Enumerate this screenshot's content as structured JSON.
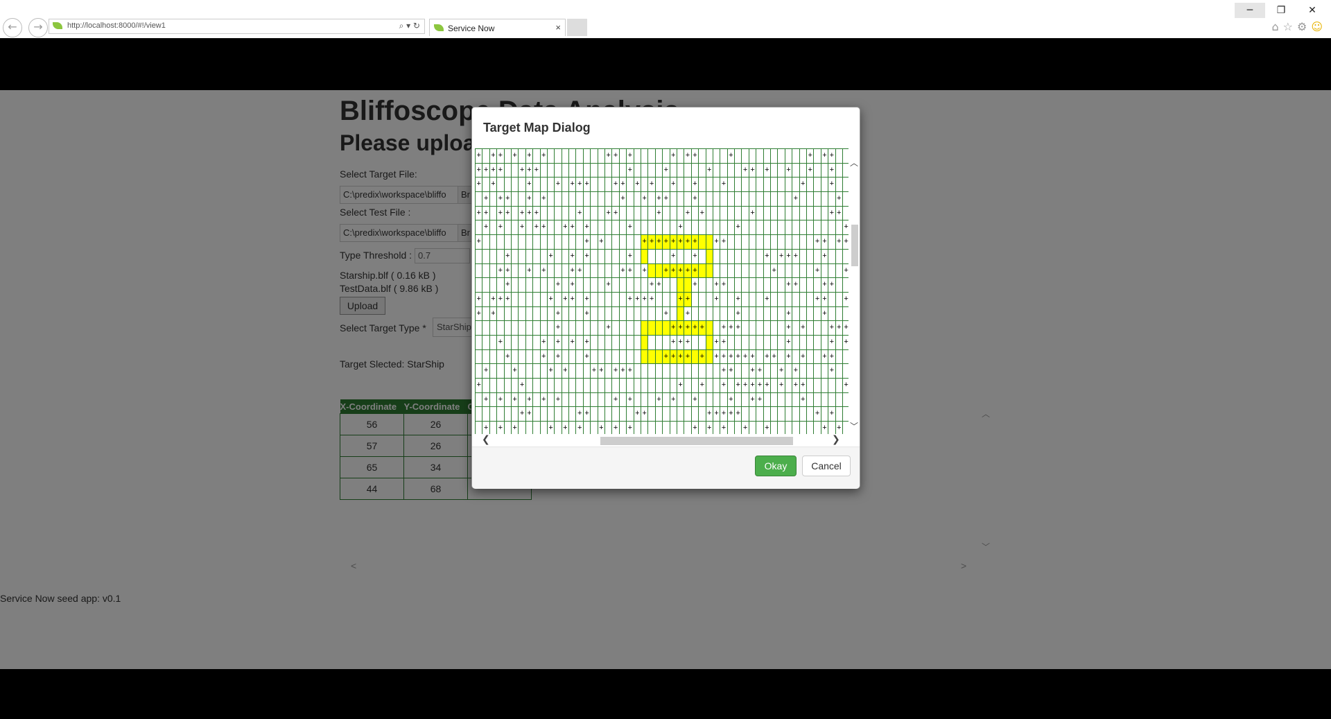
{
  "browser": {
    "url": "http://localhost:8000/#!/view1",
    "tab_title": "Service Now",
    "tab_close": "×",
    "back": "←",
    "forward": "→",
    "addr_tools": "⌕ ▾ ↻",
    "win_min": "─",
    "win_max": "❐",
    "win_close": "✕",
    "icons": "⌂☆⚙"
  },
  "page": {
    "title": "Bliffoscope Data Analysis",
    "subtitle": "Please upload",
    "target_file_label": "Select Target File:",
    "target_file_value": "C:\\predix\\workspace\\bliffo",
    "browse_label": "Br",
    "test_file_label": "Select Test File :",
    "test_file_value": "C:\\predix\\workspace\\bliffo",
    "threshold_label": "Type Threshold :",
    "threshold_value": "0.7",
    "file1": "Starship.blf ( 0.16 kB )",
    "file2": "TestData.blf ( 9.86 kB )",
    "upload_label": "Upload",
    "target_type_label": "Select Target Type *",
    "target_type_value": "StarShip",
    "target_selected": "Target Slected: StarShip",
    "table": {
      "headers": [
        "X-Coordinate",
        "Y-Coordinate",
        "C"
      ],
      "rows": [
        [
          "56",
          "26"
        ],
        [
          "57",
          "26"
        ],
        [
          "65",
          "34"
        ],
        [
          "44",
          "68"
        ]
      ]
    },
    "footer": "Service Now seed app: v0.1"
  },
  "modal": {
    "title": "Target Map Dialog",
    "okay_label": "Okay",
    "cancel_label": "Cancel",
    "grid_rows": [
      "+ ++ + + +        ++ +     + ++    +          + ++ ",
      "++++  +++            +    +     +    ++ +  +  +  +  ",
      "+ +    +   + +++   ++ + +  +  +   +          +   +  ",
      " + ++  + +          +  + ++   +             +     + ",
      "++ ++ +++     +   ++     +   + +      +          ++ ",
      " + +  + ++  ++ +     +      +       +              +",
      "+              + +     ++++++++  ++            ++ ++",
      "    +     +  + +     +     +  +         + +++   +   ",
      "   ++  + +   ++     ++ +  +++++          +     +   +",
      "    +      + +    +     ++    +  ++        ++   ++  ",
      "+ +++     + ++ +     ++++   ++   +  +   +      ++  +",
      "+ +        +   +          +  +      +      +    +   ",
      "           +      +        +++++  +++      + +   +++",
      "   +     + + + +           +++   ++        +     + +",
      "    +    + +   +          ++++ + ++++++ ++ + +  ++  ",
      " +   +    + +   ++ +++            ++  ++  + +    +  ",
      "+     +                     +  +  + +++++ + ++     +",
      " + + + + + +       + +   + +  +    +  ++     +      ",
      "      ++      ++      ++        +++++          + +  ",
      " + + +    + + +  + + +        + + +  +  +       + + "
    ],
    "highlight": [
      [
        6,
        23,
        32
      ],
      [
        7,
        23
      ],
      [
        7,
        32
      ],
      [
        8,
        24,
        32
      ],
      [
        9,
        28,
        29
      ],
      [
        10,
        28,
        29
      ],
      [
        11,
        28
      ],
      [
        12,
        23,
        32
      ],
      [
        13,
        23
      ],
      [
        13,
        32
      ],
      [
        14,
        23,
        32
      ]
    ]
  }
}
